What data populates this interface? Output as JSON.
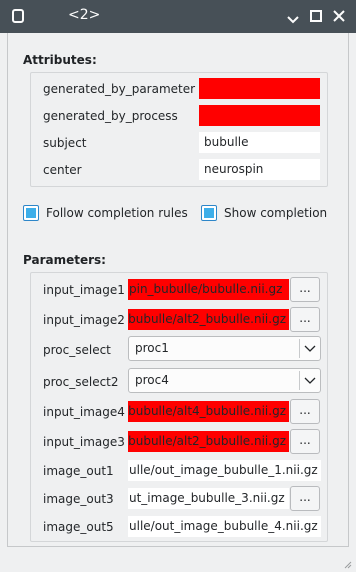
{
  "window": {
    "title": "<2>",
    "icons": {
      "app": "app-icon",
      "minimize": "minimize-icon",
      "maximize": "maximize-icon",
      "close": "close-icon"
    }
  },
  "attributes": {
    "title": "Attributes:",
    "rows": [
      {
        "label": "generated_by_parameter",
        "value": "",
        "status": "error"
      },
      {
        "label": "generated_by_process",
        "value": "",
        "status": "error"
      },
      {
        "label": "subject",
        "value": "bubulle",
        "status": "ok"
      },
      {
        "label": "center",
        "value": "neurospin",
        "status": "ok"
      }
    ]
  },
  "options": {
    "follow_completion_label": "Follow completion rules",
    "follow_completion_checked": true,
    "show_completion_label": "Show completion",
    "show_completion_checked": true
  },
  "parameters": {
    "title": "Parameters:",
    "browse_label": "...",
    "rows": [
      {
        "label": "input_image1",
        "kind": "file",
        "value": "pin_bubulle/bubulle.nii.gz",
        "status": "error"
      },
      {
        "label": "input_image2",
        "kind": "file",
        "value": "bubulle/alt2_bubulle.nii.gz",
        "status": "error"
      },
      {
        "label": "proc_select",
        "kind": "select",
        "value": "proc1"
      },
      {
        "label": "proc_select2",
        "kind": "select",
        "value": "proc4"
      },
      {
        "label": "input_image4",
        "kind": "file",
        "value": "bubulle/alt4_bubulle.nii.gz",
        "status": "error"
      },
      {
        "label": "input_image3",
        "kind": "file",
        "value": "bubulle/alt2_bubulle.nii.gz",
        "status": "error"
      },
      {
        "label": "image_out1",
        "kind": "output",
        "value": "ulle/out_image_bubulle_1.nii.gz"
      },
      {
        "label": "image_out3",
        "kind": "file",
        "value": "ut_image_bubulle_3.nii.gz",
        "status": "ok"
      },
      {
        "label": "image_out5",
        "kind": "output",
        "value": "ulle/out_image_bubulle_4.nii.gz"
      }
    ]
  },
  "colors": {
    "error": "#ff0000",
    "accent": "#3daee9",
    "titlebar": "#475057"
  }
}
